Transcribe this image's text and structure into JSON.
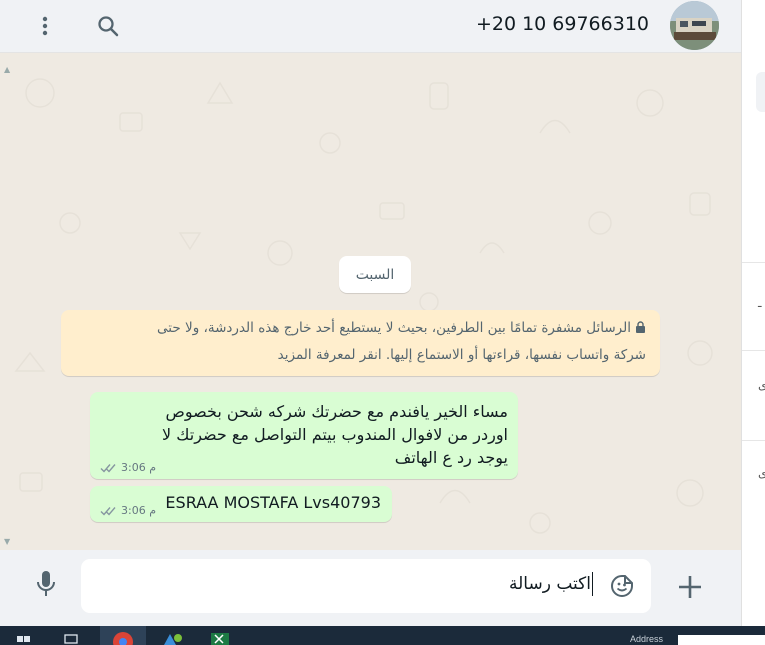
{
  "header": {
    "contact_name": "+20 10 69766310",
    "menu_icon": "kebab-menu-icon",
    "search_icon": "search-icon"
  },
  "messages": {
    "date_chip": "السبت",
    "encryption_notice": {
      "line1": "الرسائل مشفرة تمامًا بين الطرفين، بحيث لا يستطيع أحد خارج هذه الدردشة، ولا حتى",
      "line2": "شركة واتساب نفسها، قراءتها أو الاستماع إليها. انقر لمعرفة المزيد"
    },
    "items": [
      {
        "lines": [
          "مساء الخير يافندم مع حضرتك شركه شحن بخصوص",
          "اوردر من لافوال المندوب بيتم التواصل مع حضرتك لا",
          "يوجد رد ع الهاتف"
        ],
        "time": "3:06 م"
      },
      {
        "text": "ESRAA MOSTAFA Lvs40793",
        "time": "3:06 م"
      }
    ]
  },
  "composer": {
    "draft_text": "اكتب رسالة",
    "mic_icon": "microphone-icon",
    "sticker_icon": "sticker-icon",
    "attach_icon": "plus-icon"
  },
  "right_panel": {
    "chars": [
      "ـ",
      "ى",
      "ى"
    ]
  },
  "taskbar": {
    "address_label": "Address"
  },
  "colors": {
    "chat_background": "#efeae2",
    "outgoing_bubble": "#d9fdd3",
    "encryption_notice_bg": "#ffeecd",
    "header_bg": "#f0f2f5",
    "read_ticks": "#8696a0",
    "taskbar": "#1b2a3a"
  }
}
